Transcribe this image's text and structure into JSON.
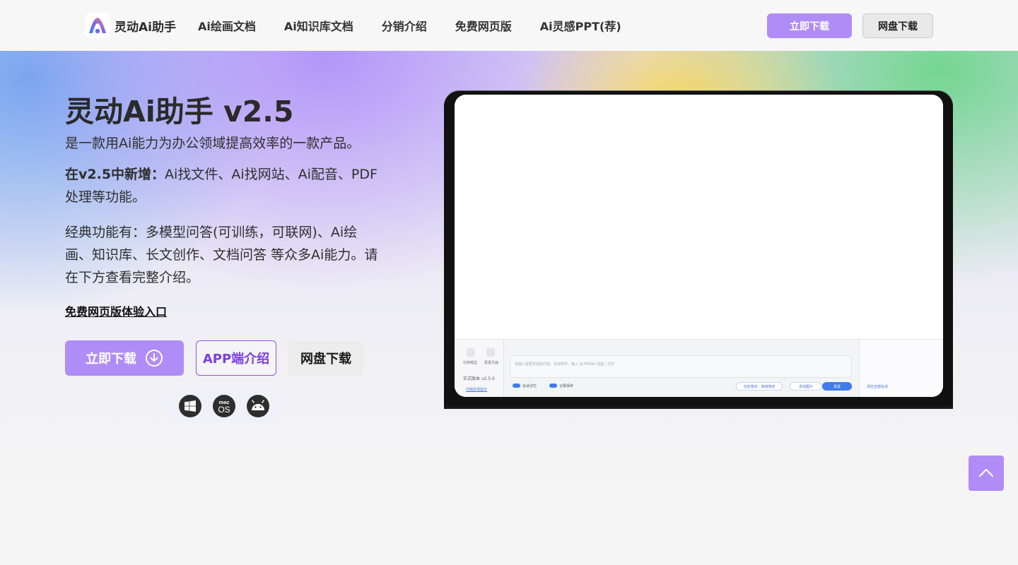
{
  "brand": {
    "logo_icon": "lingdong-logo-icon",
    "name": "灵动Ai助手",
    "colors": {
      "primary": "#b08cf6",
      "app_border": "#8a55e8",
      "app_text": "#7a3fe0"
    }
  },
  "nav": {
    "items": [
      {
        "label": "Ai绘画文档"
      },
      {
        "label": "Ai知识库文档"
      },
      {
        "label": "分销介绍"
      },
      {
        "label": "免费网页版"
      },
      {
        "label": "Ai灵感PPT(荐)"
      }
    ],
    "download_label": "立即下载",
    "pan_label": "网盘下载"
  },
  "hero": {
    "title": "灵动Ai助手 v2.5",
    "tagline": "是一款用Ai能力为办公领域提高效率的一款产品。",
    "new_prefix": "在v2.5中新增：",
    "new_text": "Ai找文件、Ai找网站、Ai配音、PDF处理等功能。",
    "classic_text": "经典功能有：多模型问答(可训练，可联网)、Ai绘画、知识库、长文创作、文档问答 等众多Ai能力。请在下方查看完整介绍。",
    "web_link": "免费网页版体验入口",
    "download_label": "立即下载",
    "download_icon": "download-circle-icon",
    "app_label": "APP端介绍",
    "pan_label": "网盘下载",
    "platforms": [
      {
        "name": "windows-icon"
      },
      {
        "name": "macos-icon",
        "text_top": "mac",
        "text_bottom": "OS"
      },
      {
        "name": "android-icon"
      }
    ]
  },
  "preview": {
    "sidebar": {
      "item1": "切换模型",
      "item2": "重置页面",
      "version_label": "正式版本",
      "version": "v2.5.0",
      "feedback": "问题反馈提交"
    },
    "input_placeholder": "请输入需要发送的内容，支持附件，输入 @ 呼叫Ai/ 技能 / 文件",
    "toggle1": "会话记忆",
    "toggle2": "记录保存",
    "chip1": "当前角色：通用角色",
    "chip2": "添加图片",
    "send": "发送",
    "clear": "清空全部会话"
  },
  "back_to_top_icon": "chevron-up-icon"
}
